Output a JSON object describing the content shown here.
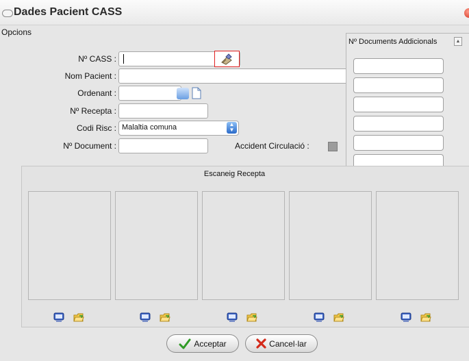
{
  "window": {
    "title": "Dades Pacient CASS"
  },
  "tabs": {
    "options": "Opcions"
  },
  "form": {
    "cass_label": "Nº CASS :",
    "cass_value": "",
    "nom_label": "Nom Pacient :",
    "ordenant_label": "Ordenant :",
    "recepta_label": "Nº Recepta :",
    "risc_label": "Codi Risc :",
    "risc_selected": "Malaltia comuna",
    "document_label": "Nº Document :",
    "accident_label": "Accident Circulació :"
  },
  "additional_docs": {
    "title": "Nº Documents Addicionals"
  },
  "scan": {
    "title": "Escaneig Recepta"
  },
  "buttons": {
    "accept": "Acceptar",
    "cancel": "Cancel·lar"
  },
  "colors": {
    "highlight_box": "#e02020",
    "accent_blue": "#2a6bc9"
  }
}
